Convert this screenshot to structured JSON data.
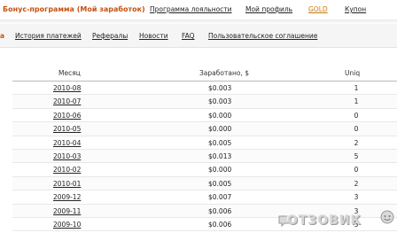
{
  "header": {
    "page_title": "Бонус-программа (Мой заработок)",
    "links": [
      "Программа лояльности",
      "Мой профиль",
      "GOLD",
      "Купон"
    ]
  },
  "subnav": {
    "active_fragment": "а",
    "items": [
      "История платежей",
      "Рефералы",
      "Новости",
      "FAQ",
      "Пользовательское соглашение"
    ]
  },
  "table": {
    "columns": [
      "Месяц",
      "Заработано, $",
      "Uniq"
    ],
    "rows": [
      {
        "month": "2010-08",
        "earned": "$0.003",
        "uniq": "1"
      },
      {
        "month": "2010-07",
        "earned": "$0.003",
        "uniq": "1"
      },
      {
        "month": "2010-06",
        "earned": "$0.000",
        "uniq": "0"
      },
      {
        "month": "2010-05",
        "earned": "$0.000",
        "uniq": "0"
      },
      {
        "month": "2010-04",
        "earned": "$0.005",
        "uniq": "2"
      },
      {
        "month": "2010-03",
        "earned": "$0.013",
        "uniq": "5"
      },
      {
        "month": "2010-02",
        "earned": "$0.000",
        "uniq": "0"
      },
      {
        "month": "2010-01",
        "earned": "$0.005",
        "uniq": "2"
      },
      {
        "month": "2009-12",
        "earned": "$0.007",
        "uniq": "3"
      },
      {
        "month": "2009-11",
        "earned": "$0.006",
        "uniq": "3"
      },
      {
        "month": "2009-10",
        "earned": "$0.006",
        "uniq": "3"
      }
    ]
  },
  "watermark": {
    "text": "ОТЗОВИК"
  },
  "colors": {
    "accent": "#c8510f",
    "gold": "#c8760a"
  }
}
